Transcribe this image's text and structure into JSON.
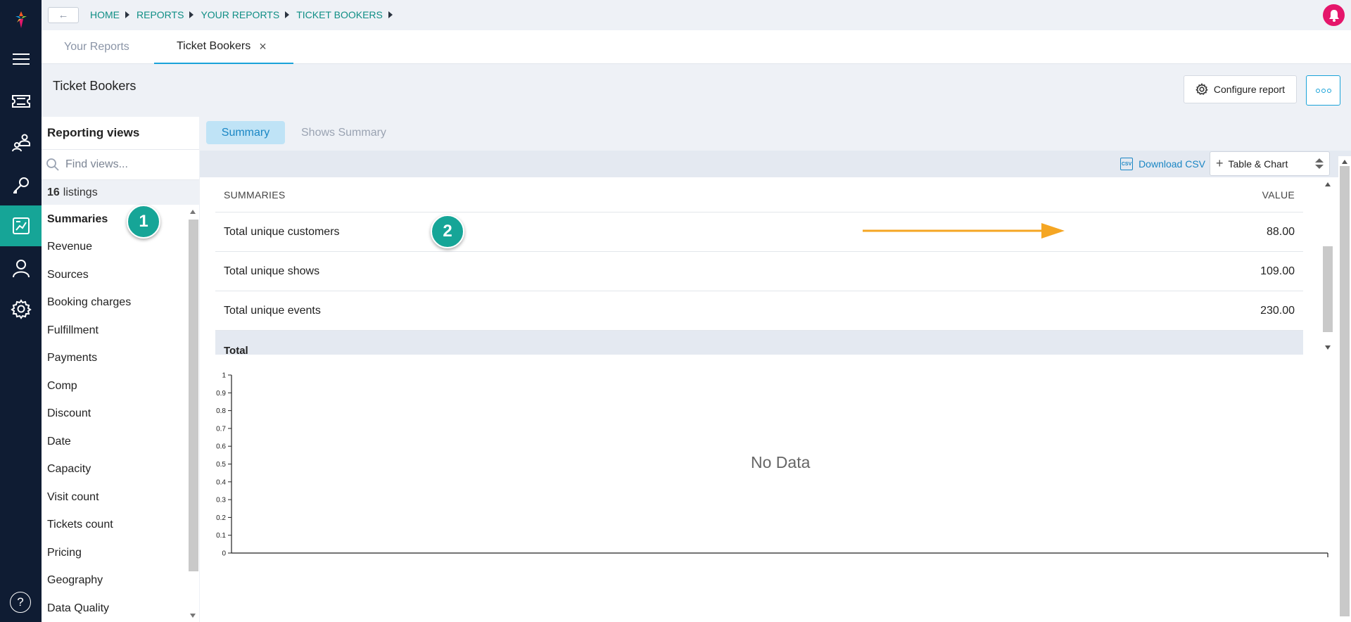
{
  "breadcrumb": [
    "HOME",
    "REPORTS",
    "YOUR REPORTS",
    "TICKET BOOKERS"
  ],
  "tabs": [
    {
      "label": "Your Reports"
    },
    {
      "label": "Ticket Bookers",
      "close": "×"
    }
  ],
  "page": {
    "title": "Ticket Bookers",
    "configure_label": "Configure report"
  },
  "views": {
    "title": "Reporting views",
    "search_placeholder": "Find views...",
    "listings_count": "16",
    "listings_label": "listings",
    "items": [
      "Summaries",
      "Revenue",
      "Sources",
      "Booking charges",
      "Fulfillment",
      "Payments",
      "Comp",
      "Discount",
      "Date",
      "Capacity",
      "Visit count",
      "Tickets count",
      "Pricing",
      "Geography",
      "Data Quality"
    ],
    "active": "Summaries"
  },
  "subtabs": {
    "summary": "Summary",
    "shows_summary": "Shows Summary"
  },
  "toolbar": {
    "csv_icon": "CSV",
    "download_csv": "Download CSV",
    "display_mode": "Table & Chart"
  },
  "table": {
    "col_summaries": "SUMMARIES",
    "col_value": "VALUE",
    "rows": [
      {
        "label": "Total unique customers",
        "value": "88.00"
      },
      {
        "label": "Total unique shows",
        "value": "109.00"
      },
      {
        "label": "Total unique events",
        "value": "230.00"
      }
    ],
    "footer_label": "Total"
  },
  "annotations": {
    "badge_1": "1",
    "badge_2": "2",
    "arrow_color": "#f5a623"
  },
  "chart_data": {
    "type": "bar",
    "categories": [],
    "values": [],
    "ylim": [
      0,
      1
    ],
    "yticks": [
      "0",
      "0.1",
      "0.2",
      "0.3",
      "0.4",
      "0.5",
      "0.6",
      "0.7",
      "0.8",
      "0.9",
      "1"
    ],
    "empty_message": "No Data"
  },
  "help_label": "?",
  "colors": {
    "accent": "#16a597",
    "link": "#0f8e85",
    "rail": "#0f1c33",
    "notification": "#e5166b"
  }
}
